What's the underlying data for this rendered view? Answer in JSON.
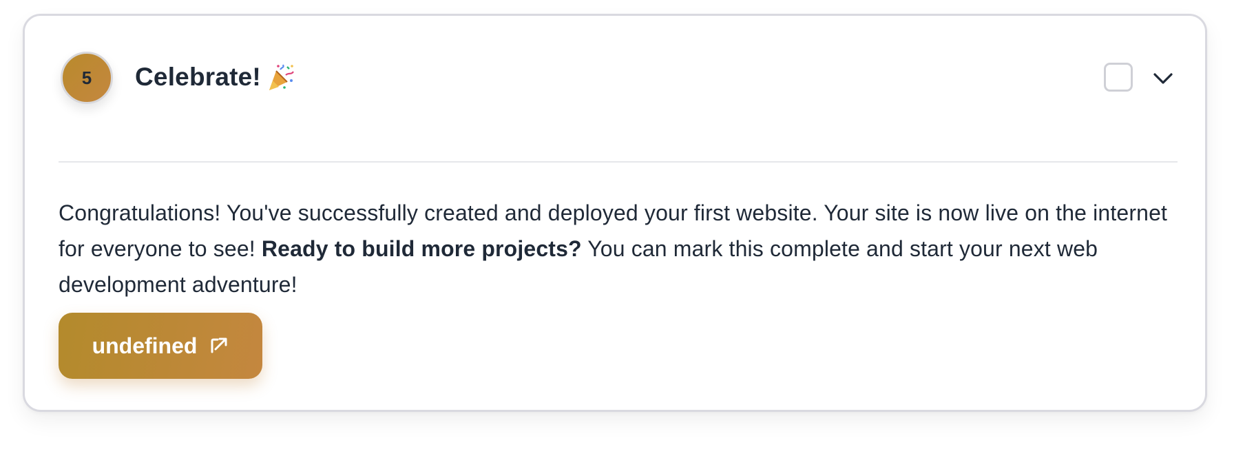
{
  "step": {
    "number": "5",
    "title": "Celebrate!",
    "title_icon": "party-popper-icon",
    "completed": false,
    "expanded": true
  },
  "description": {
    "intro": "Congratulations! You've successfully created and deployed your first website. Your site is now live on the internet for everyone to see! ",
    "emphasis": "Ready to build more projects?",
    "outro": " You can mark this complete and start your next web development adventure!"
  },
  "action": {
    "label": "undefined",
    "icon": "external-link-icon"
  },
  "colors": {
    "accent_start": "#b38a2c",
    "accent_end": "#c4873f",
    "text": "#1f2937",
    "border": "#d9d9e0"
  }
}
